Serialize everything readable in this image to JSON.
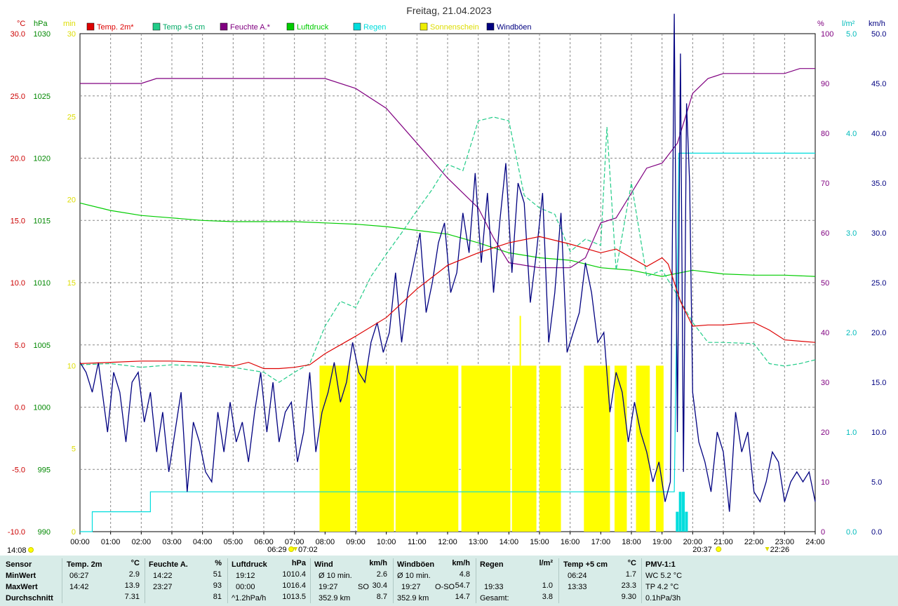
{
  "chart_data": {
    "type": "line",
    "title": "Freitag, 21.04.2023",
    "x_ticks": [
      "00:00",
      "01:00",
      "02:00",
      "03:00",
      "04:00",
      "05:00",
      "06:00",
      "07:00",
      "08:00",
      "09:00",
      "10:00",
      "11:00",
      "12:00",
      "13:00",
      "14:00",
      "15:00",
      "16:00",
      "17:00",
      "18:00",
      "19:00",
      "20:00",
      "21:00",
      "22:00",
      "23:00",
      "24:00"
    ],
    "axes": {
      "temp": {
        "unit": "°C",
        "ticks": [
          "30.0",
          "25.0",
          "20.0",
          "15.0",
          "10.0",
          "5.0",
          "0.0",
          "-5.0",
          "-10.0"
        ],
        "range": [
          -10,
          30
        ],
        "color": "#cc0000"
      },
      "pressure": {
        "unit": "hPa",
        "ticks": [
          "1030",
          "1025",
          "1020",
          "1015",
          "1010",
          "1005",
          "1000",
          "995",
          "990"
        ],
        "range": [
          990,
          1030
        ],
        "color": "#008800"
      },
      "sunmin": {
        "unit": "min",
        "ticks": [
          "30",
          "25",
          "20",
          "15",
          "10",
          "5",
          "0"
        ],
        "range": [
          0,
          30
        ],
        "color": "#dddd00"
      },
      "humidity": {
        "unit": "%",
        "ticks": [
          "100",
          "90",
          "80",
          "70",
          "60",
          "50",
          "40",
          "30",
          "20",
          "10",
          "0"
        ],
        "range": [
          0,
          100
        ],
        "color": "#800080"
      },
      "rain": {
        "unit": "l/m²",
        "ticks": [
          "5.0",
          "4.0",
          "3.0",
          "2.0",
          "1.0",
          "0.0"
        ],
        "range": [
          0,
          5
        ],
        "color": "#00bbbb"
      },
      "wind": {
        "unit": "km/h",
        "ticks": [
          "50.0",
          "45.0",
          "40.0",
          "35.0",
          "30.0",
          "25.0",
          "20.0",
          "15.0",
          "10.0",
          "5.0",
          "0.0"
        ],
        "range": [
          0,
          50
        ],
        "color": "#000080"
      }
    },
    "legend": [
      {
        "name": "Temp. 2m*",
        "color": "#dd0000"
      },
      {
        "name": "Temp +5 cm",
        "color": "#22cc88"
      },
      {
        "name": "Feuchte A.*",
        "color": "#800080"
      },
      {
        "name": "Luftdruck",
        "color": "#00cc00"
      },
      {
        "name": "Regen",
        "color": "#00dddd"
      },
      {
        "name": "Sonnenschein",
        "color": "#eeee00"
      },
      {
        "name": "Windböen",
        "color": "#000080"
      }
    ],
    "series": {
      "temp2m": {
        "x": [
          0,
          1,
          2,
          3,
          4,
          5,
          5.5,
          6,
          6.5,
          7,
          7.5,
          8,
          9,
          10,
          11,
          12,
          13,
          14,
          15,
          16,
          17,
          17.5,
          18,
          18.5,
          19,
          19.2,
          19.6,
          20,
          20.5,
          21,
          22,
          22.5,
          23,
          24
        ],
        "y": [
          3.5,
          3.6,
          3.7,
          3.7,
          3.6,
          3.3,
          3.6,
          3.1,
          3.1,
          3.2,
          3.4,
          4.3,
          5.7,
          7.2,
          9.5,
          11.4,
          12.4,
          13.2,
          13.7,
          13.1,
          12.4,
          12.7,
          12.0,
          11.3,
          12.0,
          11.5,
          8.5,
          6.5,
          6.6,
          6.6,
          6.8,
          6.2,
          5.4,
          5.2
        ]
      },
      "temp5cm": {
        "x": [
          0,
          1,
          2,
          3,
          4,
          5,
          6,
          6.5,
          7,
          7.5,
          8,
          8.5,
          9,
          9.5,
          10,
          10.5,
          11,
          11.5,
          12,
          12.5,
          13,
          13.5,
          14,
          14.5,
          15,
          15.5,
          16,
          16.5,
          17,
          17.2,
          17.5,
          18,
          18.5,
          19,
          19.5,
          20,
          20.5,
          21,
          22,
          22.5,
          23,
          23.5,
          24
        ],
        "y": [
          3.4,
          3.5,
          3.2,
          3.4,
          3.3,
          3.2,
          2.8,
          2.0,
          2.8,
          3.5,
          6.5,
          8.5,
          8.0,
          10.5,
          12.3,
          14.0,
          15.8,
          17.5,
          19.5,
          19.0,
          23.0,
          23.3,
          23.0,
          17.0,
          16.0,
          15.5,
          12.5,
          13.5,
          13.0,
          22.5,
          11.0,
          18.0,
          10.5,
          11.0,
          9.0,
          6.8,
          5.2,
          5.2,
          5.1,
          3.5,
          3.3,
          3.5,
          3.8
        ]
      },
      "humidity": {
        "x": [
          0,
          1,
          2,
          2.5,
          3,
          4,
          5,
          6,
          7,
          8,
          9,
          10,
          11,
          12,
          13,
          13.5,
          14,
          15,
          16,
          16.5,
          17,
          17.5,
          18,
          18.5,
          19,
          19.5,
          20,
          20.5,
          21,
          22,
          23,
          23.5,
          24
        ],
        "y": [
          90,
          90,
          90,
          91,
          91,
          91,
          91,
          91,
          91,
          91,
          89,
          85,
          78,
          71,
          65,
          59,
          54,
          53,
          53,
          55,
          62,
          63,
          68,
          73,
          74,
          78,
          88,
          91,
          92,
          92,
          92,
          93,
          93
        ]
      },
      "pressure": {
        "x": [
          0,
          1,
          2,
          3,
          4,
          5,
          6,
          7,
          8,
          9,
          10,
          11,
          12,
          13,
          14,
          15,
          16,
          17,
          18,
          19,
          20,
          21,
          22,
          23,
          24
        ],
        "y": [
          1016.4,
          1015.8,
          1015.4,
          1015.2,
          1015.0,
          1014.9,
          1014.9,
          1014.9,
          1014.8,
          1014.7,
          1014.5,
          1014.2,
          1013.9,
          1013.2,
          1012.4,
          1012.0,
          1011.8,
          1011.2,
          1011.0,
          1010.5,
          1011.0,
          1010.7,
          1010.6,
          1010.6,
          1010.5
        ]
      },
      "rain_cumulative": {
        "x": [
          0,
          0.4,
          0.4,
          2.3,
          2.3,
          19.4,
          19.55,
          19.55,
          21,
          24
        ],
        "y": [
          0,
          0,
          0.2,
          0.2,
          0.4,
          0.4,
          3.8,
          3.8,
          3.8,
          3.8
        ]
      },
      "rain_bars": {
        "x": [
          19.45,
          19.55,
          19.65,
          19.75
        ],
        "y": [
          0.2,
          0.4,
          0.4,
          0.2
        ]
      },
      "sunshine_intervals": [
        [
          7.82,
          8.82
        ],
        [
          9.05,
          10.25
        ],
        [
          10.3,
          12.35
        ],
        [
          12.45,
          14.05
        ],
        [
          14.1,
          14.9
        ],
        [
          15,
          15.7
        ],
        [
          16.45,
          17.3
        ],
        [
          17.45,
          17.85
        ],
        [
          18.15,
          18.6
        ],
        [
          18.8,
          19.05
        ]
      ],
      "sunshine_level_min": 10,
      "sunshine_spike": {
        "x": 14.35,
        "y": 13
      },
      "gusts": {
        "x": [
          0,
          0.2,
          0.4,
          0.6,
          0.9,
          1.1,
          1.3,
          1.5,
          1.7,
          1.9,
          2.1,
          2.3,
          2.5,
          2.7,
          2.9,
          3.1,
          3.3,
          3.5,
          3.7,
          3.9,
          4.1,
          4.3,
          4.5,
          4.7,
          4.9,
          5.1,
          5.3,
          5.5,
          5.7,
          5.9,
          6.1,
          6.3,
          6.5,
          6.7,
          6.9,
          7.1,
          7.3,
          7.5,
          7.7,
          7.9,
          8.1,
          8.3,
          8.5,
          8.7,
          8.9,
          9.1,
          9.3,
          9.5,
          9.7,
          9.9,
          10.1,
          10.3,
          10.5,
          10.7,
          10.9,
          11.1,
          11.3,
          11.5,
          11.7,
          11.9,
          12.1,
          12.3,
          12.5,
          12.7,
          12.9,
          13.1,
          13.3,
          13.5,
          13.7,
          13.9,
          14.1,
          14.3,
          14.5,
          14.7,
          14.9,
          15.1,
          15.3,
          15.5,
          15.7,
          15.9,
          16.1,
          16.3,
          16.5,
          16.7,
          16.9,
          17.1,
          17.3,
          17.5,
          17.7,
          17.9,
          18.1,
          18.3,
          18.5,
          18.7,
          18.9,
          19.1,
          19.27,
          19.4,
          19.5,
          19.6,
          19.7,
          19.8,
          19.9,
          20.0,
          20.2,
          20.4,
          20.6,
          20.8,
          21.0,
          21.2,
          21.4,
          21.6,
          21.8,
          22.0,
          22.2,
          22.4,
          22.6,
          22.8,
          23.0,
          23.2,
          23.4,
          23.6,
          23.8,
          24.0
        ],
        "y": [
          17,
          16,
          14,
          17,
          10,
          16,
          14,
          9,
          15,
          16,
          11,
          14,
          8,
          12,
          6,
          10,
          14,
          4,
          11,
          9,
          6,
          5,
          12,
          8,
          13,
          9,
          11,
          7,
          12,
          16,
          10,
          15,
          9,
          12,
          13,
          7,
          10,
          16,
          8,
          12,
          14,
          17,
          13,
          15,
          19,
          16,
          15,
          19,
          21,
          18,
          20,
          26,
          19,
          24,
          27,
          30,
          22,
          25,
          29,
          31,
          24,
          26,
          32,
          28,
          36,
          27,
          34,
          24,
          31,
          37,
          26,
          35,
          33,
          23,
          28,
          34,
          19,
          24,
          32,
          18,
          20,
          22,
          27,
          24,
          19,
          20,
          12,
          16,
          14,
          9,
          13,
          10,
          8,
          5,
          7,
          3,
          5,
          52,
          10,
          48,
          6,
          43,
          35,
          14,
          9,
          7,
          4,
          10,
          8,
          2,
          12,
          8,
          10,
          4,
          3,
          5,
          8,
          7,
          3,
          5,
          6,
          5,
          6,
          3,
          6
        ]
      }
    }
  },
  "annotations": {
    "sunrise": "06:29",
    "sunset": "20:37",
    "left_time": "14:08",
    "moon_rise": "07:02",
    "moon_set": "22:26"
  },
  "footer": {
    "row_labels": [
      "Sensor",
      "MinWert",
      "MaxWert",
      "Durchschnitt"
    ],
    "temp2m": {
      "title": "Temp. 2m",
      "unit": "°C",
      "min_time": "06:27",
      "min": "2.9",
      "max_time": "14:42",
      "max": "13.9",
      "avg": "7.31"
    },
    "feuchte": {
      "title": "Feuchte A.",
      "unit": "%",
      "min_time": "14:22",
      "min": "51",
      "max_time": "23:27",
      "max": "93",
      "avg": "81"
    },
    "luftdruck": {
      "title": "Luftdruck",
      "unit": "hPa",
      "min_time": "19:12",
      "min": "1010.4",
      "max_time": "00:00",
      "max": "1016.4",
      "trend": "^1.2hPa/h",
      "avg": "1013.5"
    },
    "wind": {
      "title": "Wind",
      "unit": "km/h",
      "r1_label": "Ø 10 min.",
      "r1_val": "2.6",
      "r2_time": "19:27",
      "r2_dir": "SO",
      "r2_val": "30.4",
      "r3_dist": "352.9 km",
      "r3_val": "8.7"
    },
    "windboeen": {
      "title": "Windböen",
      "unit": "km/h",
      "r1_label": "Ø 10 min.",
      "r1_val": "4.8",
      "r2_time": "19:27",
      "r2_dir": "O-SO",
      "r2_val": "54.7",
      "r3_dist": "352.9 km",
      "r3_val": "14.7"
    },
    "regen": {
      "title": "Regen",
      "unit": "l/m²",
      "r2_time": "19:33",
      "r2_val": "1.0",
      "r3_label": "Gesamt:",
      "r3_val": "3.8"
    },
    "temp5cm": {
      "title": "Temp +5 cm",
      "unit": "°C",
      "min_time": "06:24",
      "min": "1.7",
      "max_time": "13:33",
      "max": "23.3",
      "avg": "9.30"
    },
    "pmv": {
      "title": "PMV-1:1",
      "r1": "WC 5.2 °C",
      "r2": "TP 4.2 °C",
      "r3": "0.1hPa/3h"
    }
  }
}
